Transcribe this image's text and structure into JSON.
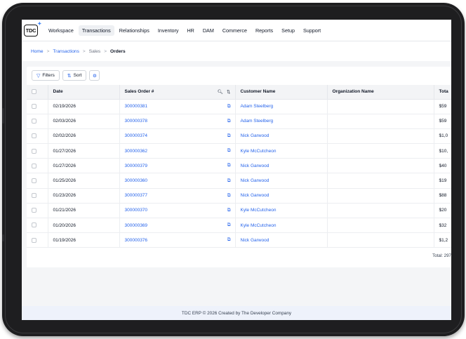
{
  "logo": {
    "text": "TDC"
  },
  "nav": {
    "items": [
      "Workspace",
      "Transactions",
      "Relationships",
      "Inventory",
      "HR",
      "DAM",
      "Commerce",
      "Reports",
      "Setup",
      "Support"
    ],
    "active": "Transactions"
  },
  "breadcrumb": {
    "home": "Home",
    "transactions": "Transactions",
    "sales": "Sales",
    "orders": "Orders",
    "separator": ">"
  },
  "toolbar": {
    "filters_label": "Filters",
    "sort_label": "Sort"
  },
  "table": {
    "columns": {
      "date": "Date",
      "sales_order": "Sales Order #",
      "customer": "Customer Name",
      "organization": "Organization Name",
      "total": "Tota"
    },
    "rows": [
      {
        "date": "02/19/2026",
        "order": "300000381",
        "customer": "Adam Steelberg",
        "organization": "",
        "total": "$59"
      },
      {
        "date": "02/03/2026",
        "order": "300000378",
        "customer": "Adam Steelberg",
        "organization": "",
        "total": "$59"
      },
      {
        "date": "02/02/2026",
        "order": "300000374",
        "customer": "Nick Garwood",
        "organization": "",
        "total": "$1,0"
      },
      {
        "date": "01/27/2026",
        "order": "300000362",
        "customer": "Kyle McCutcheon",
        "organization": "",
        "total": "$10,"
      },
      {
        "date": "01/27/2026",
        "order": "300000379",
        "customer": "Nick Garwood",
        "organization": "",
        "total": "$40"
      },
      {
        "date": "01/25/2026",
        "order": "300000360",
        "customer": "Nick Garwood",
        "organization": "",
        "total": "$19"
      },
      {
        "date": "01/23/2026",
        "order": "300000377",
        "customer": "Nick Garwood",
        "organization": "",
        "total": "$88"
      },
      {
        "date": "01/21/2026",
        "order": "300000370",
        "customer": "Kyle McCutcheon",
        "organization": "",
        "total": "$20"
      },
      {
        "date": "01/20/2026",
        "order": "300000369",
        "customer": "Kyle McCutcheon",
        "organization": "",
        "total": "$32"
      },
      {
        "date": "01/19/2026",
        "order": "300000376",
        "customer": "Nick Garwood",
        "organization": "",
        "total": "$1,2"
      }
    ]
  },
  "summary": {
    "total_text": "Total: 297"
  },
  "footer": {
    "text": "TDC ERP © 2026 Created by The Developer Company"
  },
  "icons": {
    "filter": "filter-icon",
    "sort": "sort-icon",
    "settings": "gear-icon",
    "search": "search-icon",
    "copy": "copy-icon"
  },
  "colors": {
    "accent": "#2563eb",
    "footer_bg": "#eef2fb",
    "device": "#1e1e20"
  }
}
